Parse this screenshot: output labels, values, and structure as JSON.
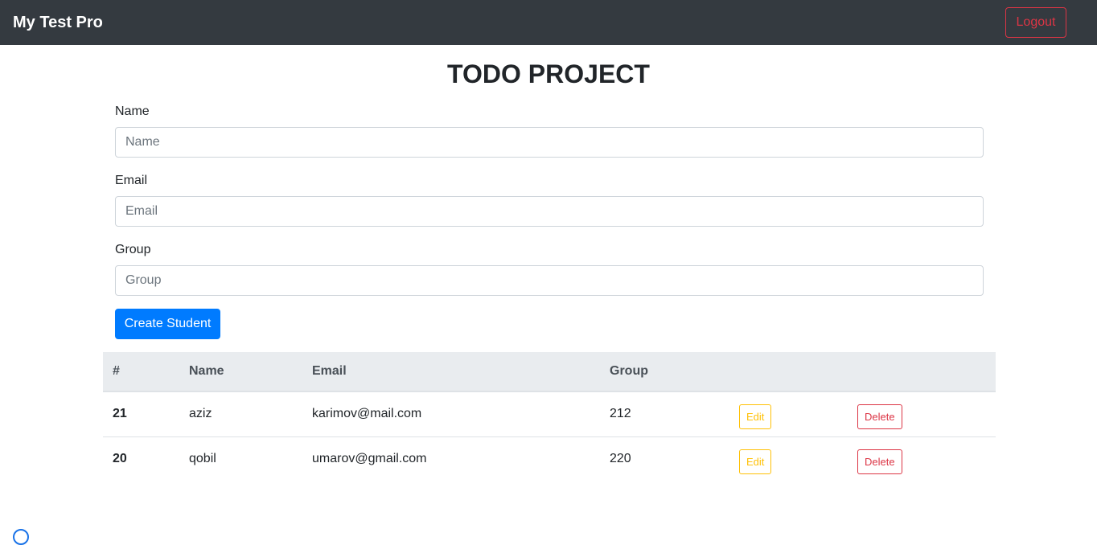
{
  "navbar": {
    "brand": "My Test Pro",
    "logout_label": "Logout"
  },
  "page": {
    "title": "TODO PROJECT"
  },
  "form": {
    "name_label": "Name",
    "name_placeholder": "Name",
    "name_value": "",
    "email_label": "Email",
    "email_placeholder": "Email",
    "email_value": "",
    "group_label": "Group",
    "group_placeholder": "Group",
    "group_value": "",
    "submit_label": "Create Student"
  },
  "table": {
    "headers": [
      "#",
      "Name",
      "Email",
      "Group",
      "",
      ""
    ],
    "rows": [
      {
        "id": "21",
        "name": "aziz",
        "email": "karimov@mail.com",
        "group": "212",
        "edit_label": "Edit",
        "delete_label": "Delete"
      },
      {
        "id": "20",
        "name": "qobil",
        "email": "umarov@gmail.com",
        "group": "220",
        "edit_label": "Edit",
        "delete_label": "Delete"
      }
    ]
  },
  "colors": {
    "navbar_bg": "#343a40",
    "primary": "#007bff",
    "danger": "#dc3545",
    "warning": "#ffc107",
    "table_head_bg": "#e9ecef"
  }
}
